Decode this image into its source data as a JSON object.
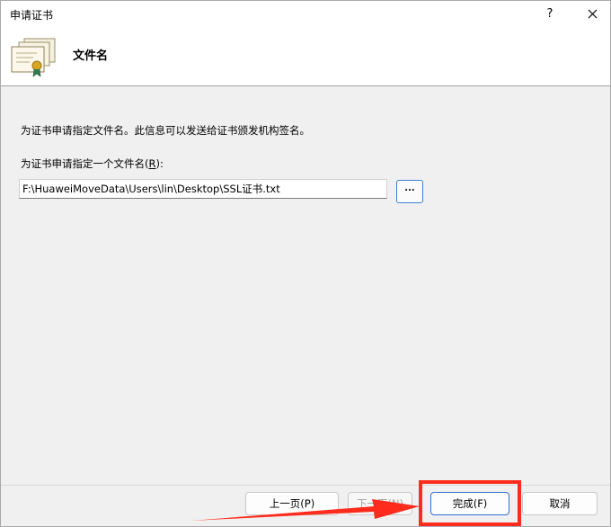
{
  "window": {
    "title": "申请证书",
    "help_label": "?"
  },
  "header": {
    "title": "文件名",
    "icon": "certificate-icon"
  },
  "body": {
    "description": "为证书申请指定文件名。此信息可以发送给证书颁发机构签名。",
    "field_label_prefix": "为证书申请指定一个文件名(",
    "field_label_accesskey": "R",
    "field_label_suffix": "):",
    "path_value": "F:\\HuaweiMoveData\\Users\\lin\\Desktop\\SSL证书.txt",
    "browse_label": "..."
  },
  "footer": {
    "back_label": "上一页(P)",
    "next_label": "下一页(N)",
    "finish_label": "完成(F)",
    "cancel_label": "取消"
  },
  "colors": {
    "annotation": "#ff2b1c",
    "focus_border": "#2f6fd1"
  }
}
